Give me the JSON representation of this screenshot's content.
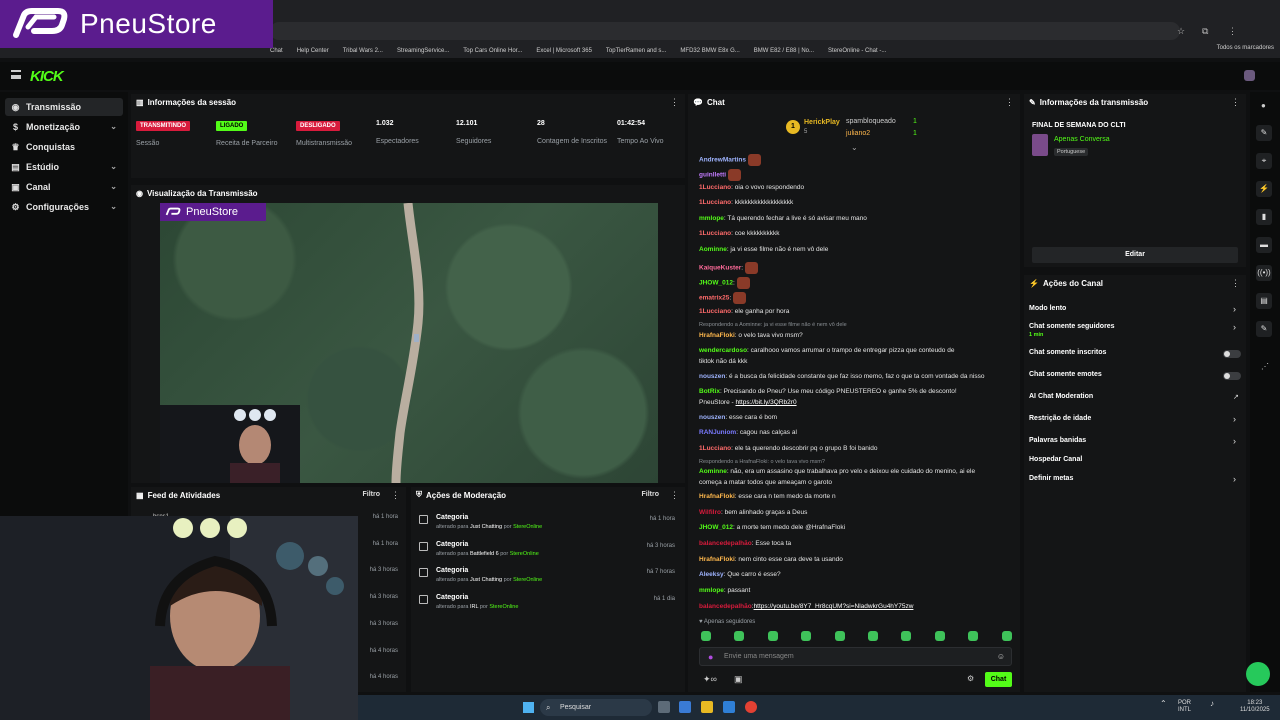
{
  "browser": {
    "bookmarks": [
      "Chat",
      "Help Center",
      "Tribal Wars 2...",
      "StreamingService...",
      "Top Cars Online Hor...",
      "Excel | Microsoft 365",
      "TopTierRamen and s...",
      "MFD32 BMW E8x G...",
      "BMW E82 / E88 | No...",
      "StereOnline - Chat -..."
    ],
    "all_bookmarks": "Todos os marcadores"
  },
  "logo": {
    "text": "PneuStore",
    "overlay_text": "PneuStore"
  },
  "kick": {
    "logo": "KICK"
  },
  "sidebar": {
    "items": [
      {
        "label": "Transmissão",
        "icon": "broadcast-icon",
        "active": true,
        "expand": false
      },
      {
        "label": "Monetização",
        "icon": "money-icon",
        "active": false,
        "expand": true
      },
      {
        "label": "Conquistas",
        "icon": "trophy-icon",
        "active": false,
        "expand": false
      },
      {
        "label": "Estúdio",
        "icon": "studio-icon",
        "active": false,
        "expand": true
      },
      {
        "label": "Canal",
        "icon": "channel-icon",
        "active": false,
        "expand": true
      },
      {
        "label": "Configurações",
        "icon": "gear-icon",
        "active": false,
        "expand": true
      }
    ]
  },
  "session": {
    "title": "Informações da sessão",
    "stats": [
      {
        "badge": "TRANSMITINDO",
        "badge_color": "#d81b3c",
        "label": "Sessão"
      },
      {
        "badge": "LIGADO",
        "badge_color": "#53fc18",
        "label": "Receita de Parceiro"
      },
      {
        "badge": "DESLIGADO",
        "badge_color": "#d81b3c",
        "label": "Multistransmissão"
      },
      {
        "value": "1.032",
        "label": "Espectadores"
      },
      {
        "value": "12.101",
        "label": "Seguidores"
      },
      {
        "value": "28",
        "label": "Contagem de Inscritos"
      },
      {
        "value": "01:42:54",
        "label": "Tempo Ao Vivo"
      }
    ]
  },
  "preview": {
    "title": "Visualização da Transmissão"
  },
  "feed": {
    "title": "Feed de Atividades",
    "filter": "Filtro",
    "first_name": "bsns1",
    "times": [
      "há 1 hora",
      "há 1 hora",
      "há 3 horas",
      "há 3 horas",
      "há 3 horas",
      "há 4 horas",
      "há 4 horas"
    ]
  },
  "moderation": {
    "title": "Ações de Moderação",
    "filter": "Filtro",
    "rows": [
      {
        "title": "Categoria",
        "changed": "alterado para",
        "category": "Just Chatting",
        "by": "por",
        "who": "StereOnline",
        "time": "há 1 hora"
      },
      {
        "title": "Categoria",
        "changed": "alterado para",
        "category": "Battlefield 6",
        "by": "por",
        "who": "StereOnline",
        "time": "há 3 horas"
      },
      {
        "title": "Categoria",
        "changed": "alterado para",
        "category": "Just Chatting",
        "by": "por",
        "who": "StereOnline",
        "time": "há 7 horas"
      },
      {
        "title": "Categoria",
        "changed": "alterado para",
        "category": "IRL",
        "by": "por",
        "who": "StereOnline",
        "time": "há 1 dia"
      }
    ]
  },
  "chat": {
    "title": "Chat",
    "pinned": {
      "user": "HerickPlay",
      "count": "5",
      "rank": "1",
      "others": [
        {
          "user": "spambloqueado",
          "n": "1"
        },
        {
          "user": "juliano2",
          "n": "1"
        }
      ]
    },
    "messages": [
      {
        "user": "AndrewMartins",
        "color": "#9fb4ff",
        "text": "",
        "emote": true
      },
      {
        "user": "guinlletti",
        "color": "#c37bff",
        "text": "",
        "emote": true
      },
      {
        "user": "1Lucciano",
        "color": "#ff6b6b",
        "text": ": oia o vovo respondendo"
      },
      {
        "user": "1Lucciano",
        "color": "#ff6b6b",
        "text": ": kkkkkkkkkkkkkkkkkk"
      },
      {
        "user": "mmlope",
        "color": "#53fc18",
        "text": ": Tá querendo fechar a live é só avisar meu mano"
      },
      {
        "user": "1Lucciano",
        "color": "#ff6b6b",
        "text": ": coe kkkkkkkkkk"
      },
      {
        "user": "Aominne",
        "color": "#53fc18",
        "text": ": ja vi esse filme não é nem vô dele"
      },
      {
        "user": "KaiqueKuster",
        "color": "#ff6b9a",
        "text": ":",
        "emote": true
      },
      {
        "user": "JHOW_012",
        "color": "#53fc18",
        "text": ":",
        "emote": true
      },
      {
        "user": "ematrix25",
        "color": "#ff6b6b",
        "text": ":",
        "emote": true
      },
      {
        "user": "1Lucciano",
        "color": "#ff6b6b",
        "text": ": ele ganha por hora"
      },
      {
        "reply": "Respondendo a Aominne: ja vi esse filme não é nem vô dele"
      },
      {
        "user": "HrafnaFloki",
        "color": "#ffb84d",
        "text": ": o velo tava vivo msm?"
      },
      {
        "user": "wendercardoso",
        "color": "#53fc18",
        "text": ": caralhooo vamos arrumar o trampo de entregar pizza que conteudo de"
      },
      {
        "cont": "tiktok não dá kkk"
      },
      {
        "user": "nouszen",
        "color": "#9fb4ff",
        "text": ": é a busca da felicidade constante que faz isso memo, faz o que ta com vontade da nisso"
      },
      {
        "user": "BotRix",
        "color": "#53fc18",
        "text": ": Precisando de Pneu? Use meu código PNEUSTEREO e ganhe 5% de desconto!"
      },
      {
        "cont": "PneuStore - ",
        "link": "https://bit.ly/3QRb2r0"
      },
      {
        "user": "nouszen",
        "color": "#9fb4ff",
        "text": ": esse cara é bom"
      },
      {
        "user": "RANJuniom",
        "color": "#7a7aff",
        "text": ": cagou nas calças al"
      },
      {
        "user": "1Lucciano",
        "color": "#ff6b6b",
        "text": ": ele ta querendo descobrir pq o grupo B foi banido"
      },
      {
        "reply": "Respondendo a HrafnaFloki: o velo tava vivo msm?"
      },
      {
        "user": "Aominne",
        "color": "#53fc18",
        "text": ": não, era um assasino que trabalhava pro velo e deixou ele cuidado do menino, ai ele"
      },
      {
        "cont": "começa a matar todos que ameaçam o garoto"
      },
      {
        "user": "HrafnaFloki",
        "color": "#ffb84d",
        "text": ": esse cara n tem medo da morte n"
      },
      {
        "user": "Wilfilro",
        "color": "#d81b3c",
        "text": ": bem alinhado graças a Deus"
      },
      {
        "user": "JHOW_012",
        "color": "#53fc18",
        "text": ": a morte tem medo dele @HrafnaFloki"
      },
      {
        "user": "balancedepalhão",
        "color": "#d81b3c",
        "text": ": Esse toca ta"
      },
      {
        "user": "HrafnaFloki",
        "color": "#ffb84d",
        "text": ": nem cinto esse cara deve ta usando"
      },
      {
        "user": "Aleeksy",
        "color": "#9fb4ff",
        "text": ": Que carro é esse?"
      },
      {
        "user": "mmlope",
        "color": "#53fc18",
        "text": ": passant"
      },
      {
        "user": "balancedepalhão",
        "color": "#d81b3c",
        "text": ":",
        "link": "https://youtu.be/8Y7_Hr8cqUM?si=NladwkrGu4hY75zw"
      }
    ],
    "followers_only": "Apenas seguidores",
    "placeholder": "Envie uma mensagem",
    "send": "Chat"
  },
  "stream_info": {
    "title": "Informações da transmissão",
    "stream_title": "FINAL DE SEMANA DO CLTI",
    "category": "Apenas Conversa",
    "language": "Portuguese",
    "edit": "Editar"
  },
  "channel_actions": {
    "title": "Ações do Canal",
    "items": [
      {
        "label": "Modo lento",
        "ctl": "arrow"
      },
      {
        "label": "Chat somente seguidores",
        "sub": "1 min",
        "ctl": "arrow"
      },
      {
        "label": "Chat somente inscritos",
        "ctl": "toggle"
      },
      {
        "label": "Chat somente emotes",
        "ctl": "toggle"
      },
      {
        "label": "AI Chat Moderation",
        "ctl": "ext"
      },
      {
        "label": "Restrição de idade",
        "ctl": "arrow"
      },
      {
        "label": "Palavras banidas",
        "ctl": "arrow"
      },
      {
        "label": "Hospedar Canal",
        "ctl": "none"
      },
      {
        "label": "Definir metas",
        "ctl": "arrow"
      }
    ]
  },
  "taskbar": {
    "search": "Pesquisar",
    "lang": "POR",
    "lang2": "INTL",
    "time": "18:23",
    "date": "11/10/2025"
  }
}
